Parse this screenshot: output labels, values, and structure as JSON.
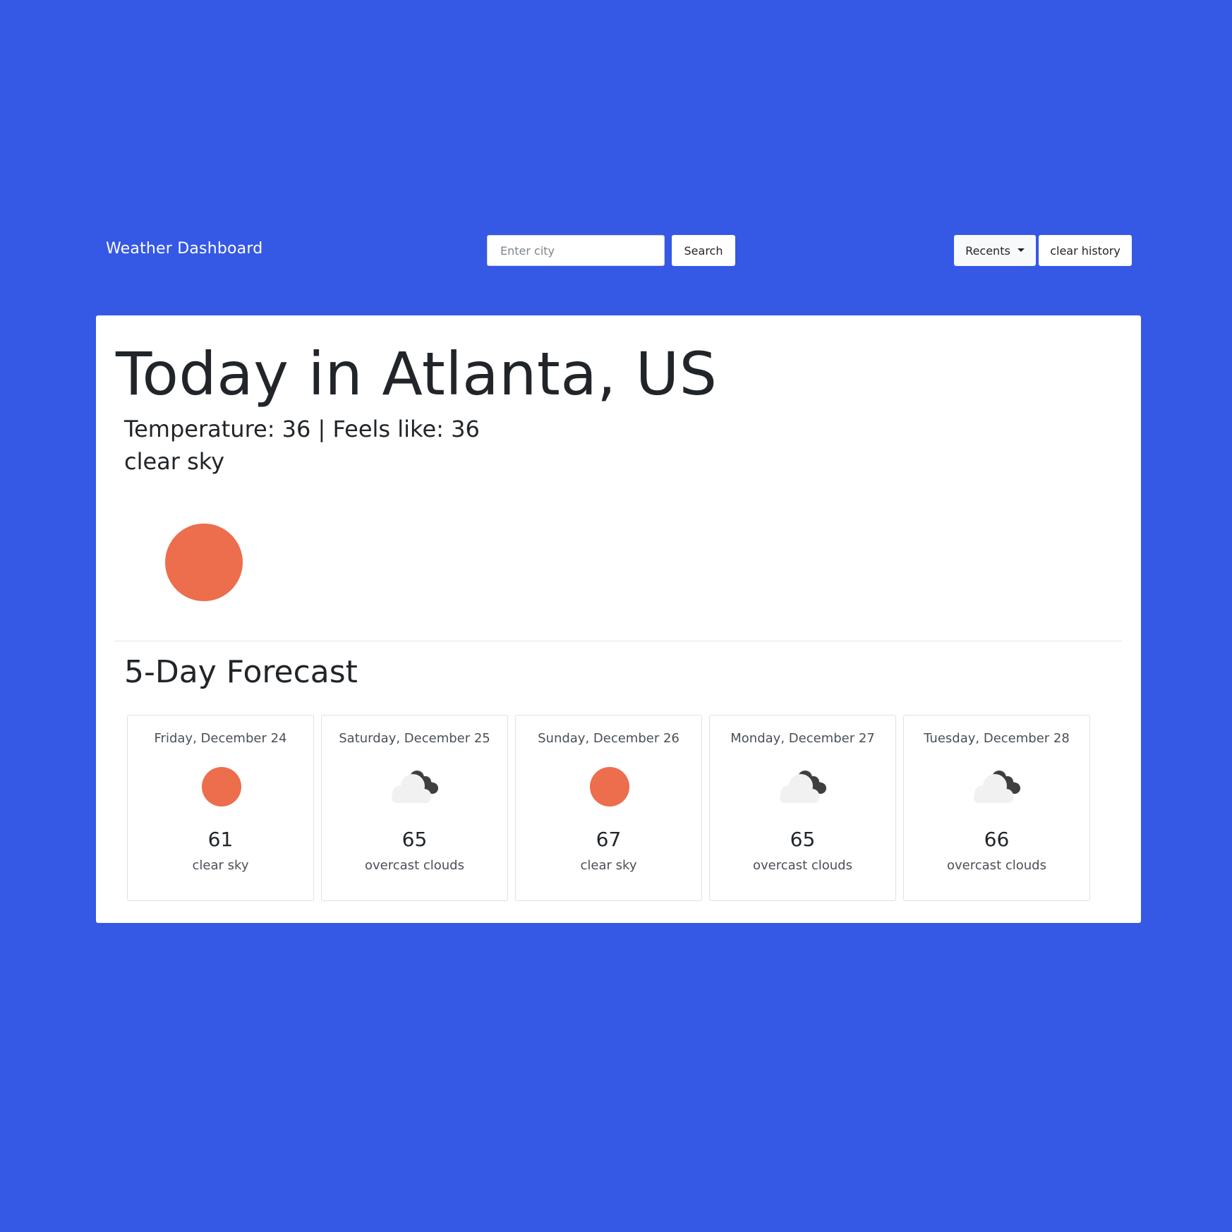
{
  "navbar": {
    "brand": "Weather Dashboard",
    "search_placeholder": "Enter city",
    "search_value": "",
    "search_label": "Search",
    "recents_label": "Recents",
    "clear_label": "clear history"
  },
  "colors": {
    "background": "#3558e5",
    "sun": "#ec6e4c",
    "cloud_light": "#f1f1f1",
    "cloud_dark": "#3f3f3f"
  },
  "today": {
    "title": "Today in Atlanta, US",
    "temperature_line": "Temperature: 36 | Feels like: 36",
    "description": "clear sky",
    "icon": "sun-icon"
  },
  "forecast": {
    "title": "5-Day Forecast",
    "days": [
      {
        "date": "Friday, December 24",
        "icon": "sun-icon",
        "temp": "61",
        "desc": "clear sky"
      },
      {
        "date": "Saturday, December 25",
        "icon": "cloud-icon",
        "temp": "65",
        "desc": "overcast clouds"
      },
      {
        "date": "Sunday, December 26",
        "icon": "sun-icon",
        "temp": "67",
        "desc": "clear sky"
      },
      {
        "date": "Monday, December 27",
        "icon": "cloud-icon",
        "temp": "65",
        "desc": "overcast clouds"
      },
      {
        "date": "Tuesday, December 28",
        "icon": "cloud-icon",
        "temp": "66",
        "desc": "overcast clouds"
      }
    ]
  }
}
